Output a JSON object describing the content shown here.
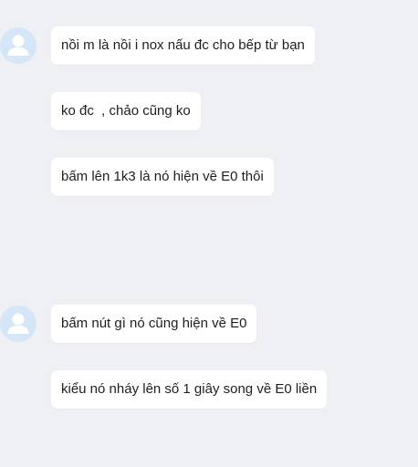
{
  "conversation": {
    "groups": [
      {
        "avatar_icon": "user-avatar-icon",
        "messages": [
          "nồi m là nồi i nox nấu đc cho bếp từ bạn",
          "ko đc  , chảo cũng ko",
          "bấm lên 1k3 là nó hiện về E0 thôi"
        ]
      },
      {
        "avatar_icon": "user-avatar-icon",
        "messages": [
          "bấm nút gì nó cũng hiện về E0",
          "kiểu nó nháy lên số 1 giây song về E0 liền"
        ]
      }
    ]
  },
  "colors": {
    "background": "#eef0f4",
    "bubble": "#ffffff",
    "avatar_bg": "#d4e6f7",
    "avatar_fg": "#ffffff",
    "text": "#1c1e21"
  }
}
